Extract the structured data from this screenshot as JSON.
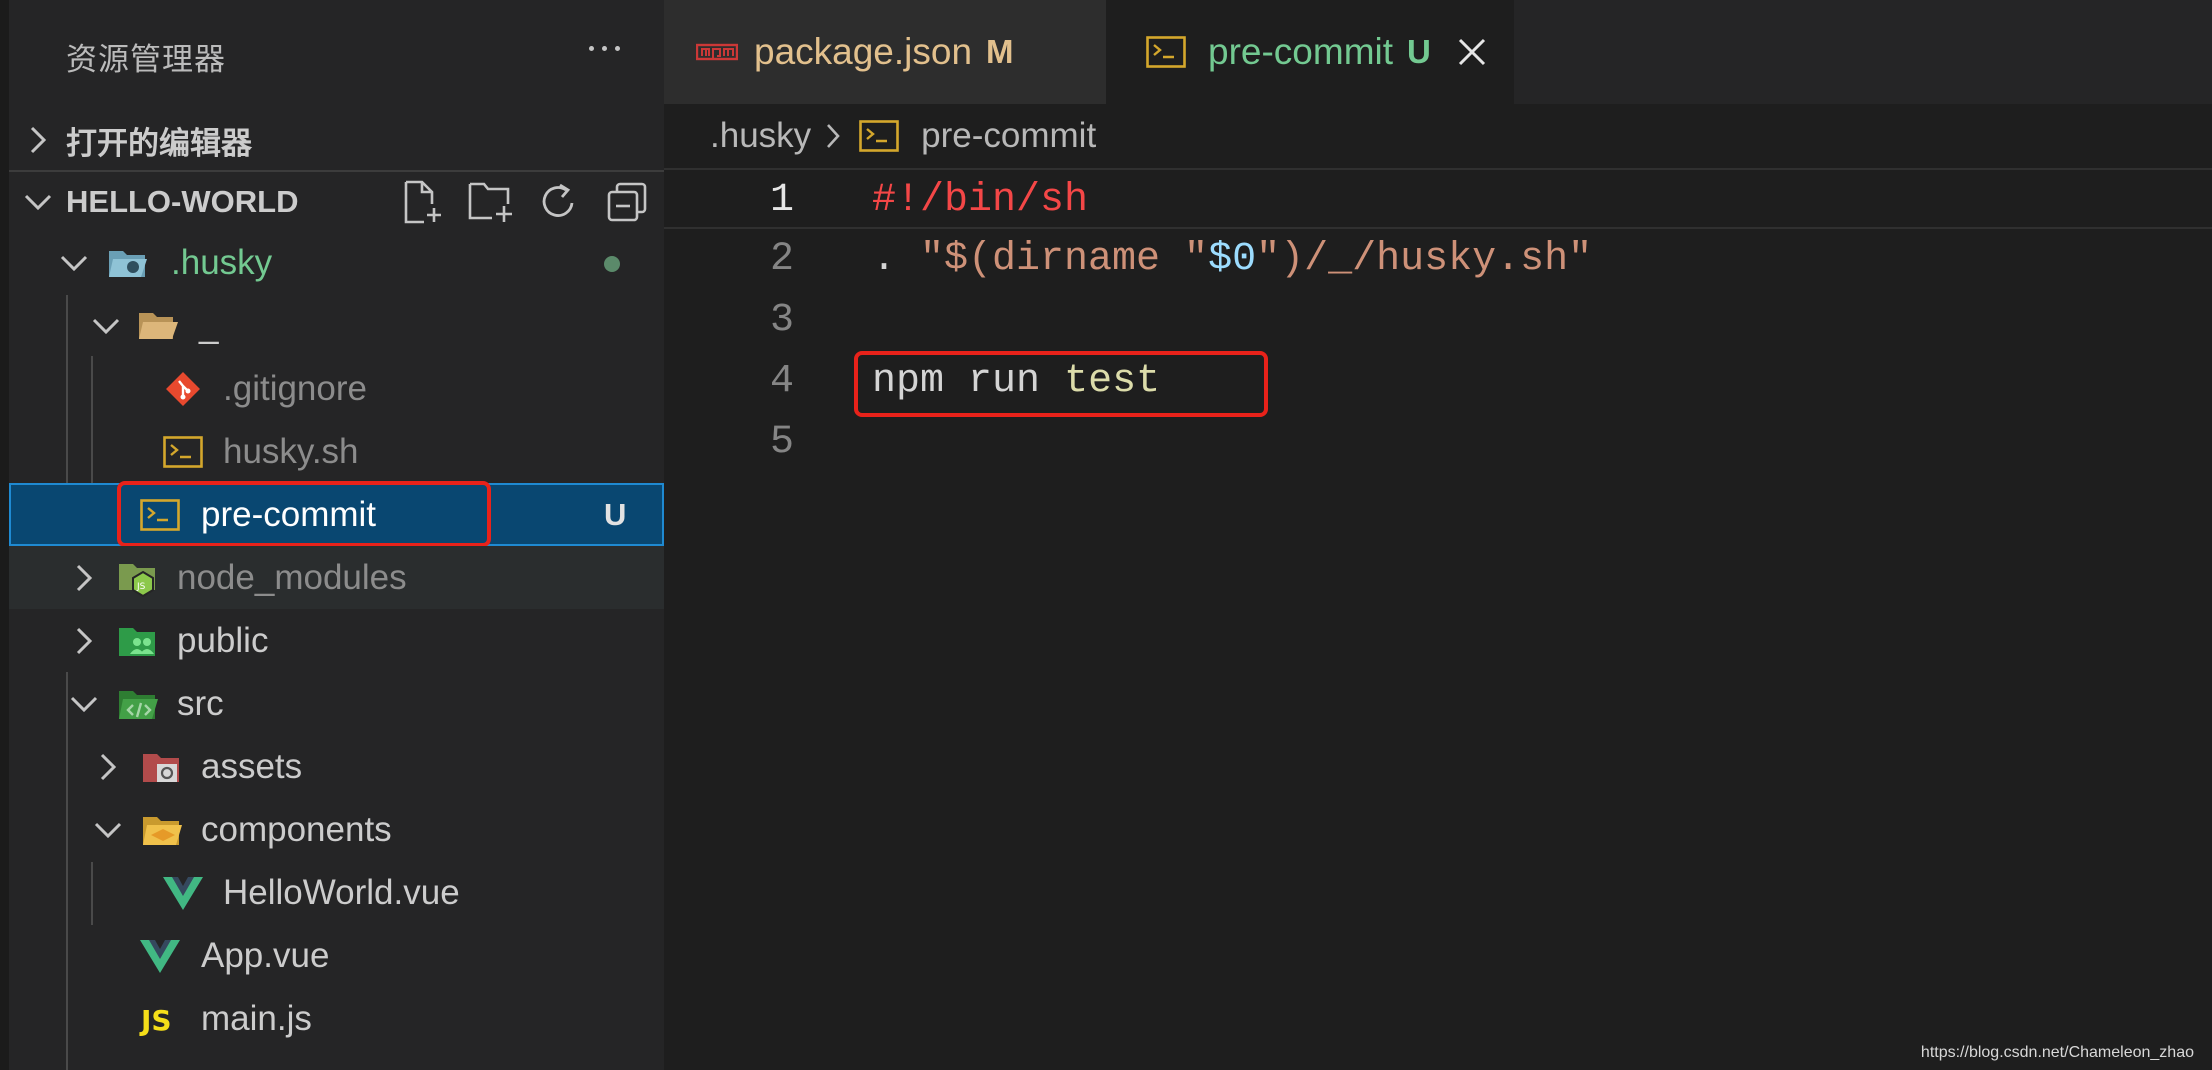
{
  "sidebar": {
    "title": "资源管理器",
    "more_icon": "ellipsis-icon",
    "open_editors_label": "打开的编辑器",
    "project_label": "HELLO-WORLD",
    "actions": [
      "new-file-icon",
      "new-folder-icon",
      "refresh-icon",
      "collapse-all-icon"
    ],
    "tree": [
      {
        "name": ".husky",
        "badge": "",
        "color": "#73c991",
        "icon": "folder-husky-icon"
      },
      {
        "name": "_",
        "badge": "",
        "color": "#cccccc",
        "icon": "folder-open-icon"
      },
      {
        "name": ".gitignore",
        "badge": "",
        "color": "#8c8c8c",
        "icon": "git-icon"
      },
      {
        "name": "husky.sh",
        "badge": "",
        "color": "#8c8c8c",
        "icon": "terminal-icon"
      },
      {
        "name": "pre-commit",
        "badge": "U",
        "color": "#ffffff",
        "icon": "terminal-icon"
      },
      {
        "name": "node_modules",
        "badge": "",
        "color": "#8c8c8c",
        "icon": "folder-node-icon"
      },
      {
        "name": "public",
        "badge": "",
        "color": "#cccccc",
        "icon": "folder-public-icon"
      },
      {
        "name": "src",
        "badge": "",
        "color": "#cccccc",
        "icon": "folder-src-icon"
      },
      {
        "name": "assets",
        "badge": "",
        "color": "#cccccc",
        "icon": "folder-assets-icon"
      },
      {
        "name": "components",
        "badge": "",
        "color": "#cccccc",
        "icon": "folder-components-icon"
      },
      {
        "name": "HelloWorld.vue",
        "badge": "",
        "color": "#cccccc",
        "icon": "vue-icon"
      },
      {
        "name": "App.vue",
        "badge": "",
        "color": "#cccccc",
        "icon": "vue-icon"
      },
      {
        "name": "main.js",
        "badge": "",
        "color": "#cccccc",
        "icon": "js-icon"
      }
    ]
  },
  "tabs": [
    {
      "label": "package.json",
      "badge": "M",
      "active": false,
      "label_color": "#e2c08d",
      "badge_color": "#e2c08d",
      "icon": "npm-icon"
    },
    {
      "label": "pre-commit",
      "badge": "U",
      "active": true,
      "label_color": "#73c991",
      "badge_color": "#73c991",
      "icon": "terminal-icon",
      "close_icon": "close-icon"
    }
  ],
  "breadcrumb": {
    "folder": ".husky",
    "file": "pre-commit",
    "separator_icon": "chevron-right-icon"
  },
  "code": {
    "line_numbers": [
      "1",
      "2",
      "3",
      "4",
      "5"
    ],
    "line1": "#!/bin/sh",
    "line2": {
      "dot": ". ",
      "q1": "\"$(dirname \"",
      "var": "$0",
      "q2": "\")/_/husky.sh\""
    },
    "line4": {
      "kw1": "npm",
      "kw2": "run",
      "arg": "test"
    }
  },
  "watermark": "https://blog.csdn.net/Chameleon_zhao",
  "colors": {
    "accent": "#094771",
    "highlight_box": "#e8221a",
    "untracked": "#73c991",
    "modified": "#e2c08d"
  }
}
